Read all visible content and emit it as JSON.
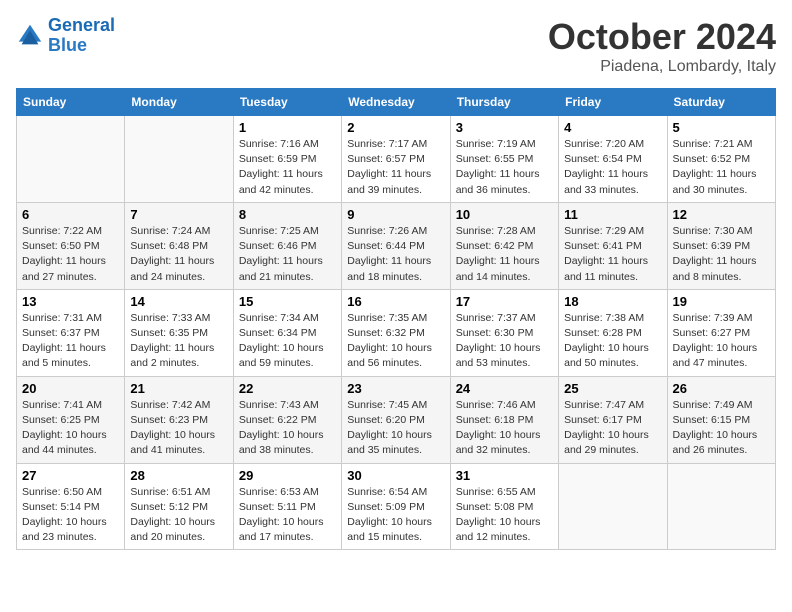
{
  "header": {
    "logo_line1": "General",
    "logo_line2": "Blue",
    "month": "October 2024",
    "location": "Piadena, Lombardy, Italy"
  },
  "weekdays": [
    "Sunday",
    "Monday",
    "Tuesday",
    "Wednesday",
    "Thursday",
    "Friday",
    "Saturday"
  ],
  "weeks": [
    [
      {
        "day": "",
        "sunrise": "",
        "sunset": "",
        "daylight": ""
      },
      {
        "day": "",
        "sunrise": "",
        "sunset": "",
        "daylight": ""
      },
      {
        "day": "1",
        "sunrise": "Sunrise: 7:16 AM",
        "sunset": "Sunset: 6:59 PM",
        "daylight": "Daylight: 11 hours and 42 minutes."
      },
      {
        "day": "2",
        "sunrise": "Sunrise: 7:17 AM",
        "sunset": "Sunset: 6:57 PM",
        "daylight": "Daylight: 11 hours and 39 minutes."
      },
      {
        "day": "3",
        "sunrise": "Sunrise: 7:19 AM",
        "sunset": "Sunset: 6:55 PM",
        "daylight": "Daylight: 11 hours and 36 minutes."
      },
      {
        "day": "4",
        "sunrise": "Sunrise: 7:20 AM",
        "sunset": "Sunset: 6:54 PM",
        "daylight": "Daylight: 11 hours and 33 minutes."
      },
      {
        "day": "5",
        "sunrise": "Sunrise: 7:21 AM",
        "sunset": "Sunset: 6:52 PM",
        "daylight": "Daylight: 11 hours and 30 minutes."
      }
    ],
    [
      {
        "day": "6",
        "sunrise": "Sunrise: 7:22 AM",
        "sunset": "Sunset: 6:50 PM",
        "daylight": "Daylight: 11 hours and 27 minutes."
      },
      {
        "day": "7",
        "sunrise": "Sunrise: 7:24 AM",
        "sunset": "Sunset: 6:48 PM",
        "daylight": "Daylight: 11 hours and 24 minutes."
      },
      {
        "day": "8",
        "sunrise": "Sunrise: 7:25 AM",
        "sunset": "Sunset: 6:46 PM",
        "daylight": "Daylight: 11 hours and 21 minutes."
      },
      {
        "day": "9",
        "sunrise": "Sunrise: 7:26 AM",
        "sunset": "Sunset: 6:44 PM",
        "daylight": "Daylight: 11 hours and 18 minutes."
      },
      {
        "day": "10",
        "sunrise": "Sunrise: 7:28 AM",
        "sunset": "Sunset: 6:42 PM",
        "daylight": "Daylight: 11 hours and 14 minutes."
      },
      {
        "day": "11",
        "sunrise": "Sunrise: 7:29 AM",
        "sunset": "Sunset: 6:41 PM",
        "daylight": "Daylight: 11 hours and 11 minutes."
      },
      {
        "day": "12",
        "sunrise": "Sunrise: 7:30 AM",
        "sunset": "Sunset: 6:39 PM",
        "daylight": "Daylight: 11 hours and 8 minutes."
      }
    ],
    [
      {
        "day": "13",
        "sunrise": "Sunrise: 7:31 AM",
        "sunset": "Sunset: 6:37 PM",
        "daylight": "Daylight: 11 hours and 5 minutes."
      },
      {
        "day": "14",
        "sunrise": "Sunrise: 7:33 AM",
        "sunset": "Sunset: 6:35 PM",
        "daylight": "Daylight: 11 hours and 2 minutes."
      },
      {
        "day": "15",
        "sunrise": "Sunrise: 7:34 AM",
        "sunset": "Sunset: 6:34 PM",
        "daylight": "Daylight: 10 hours and 59 minutes."
      },
      {
        "day": "16",
        "sunrise": "Sunrise: 7:35 AM",
        "sunset": "Sunset: 6:32 PM",
        "daylight": "Daylight: 10 hours and 56 minutes."
      },
      {
        "day": "17",
        "sunrise": "Sunrise: 7:37 AM",
        "sunset": "Sunset: 6:30 PM",
        "daylight": "Daylight: 10 hours and 53 minutes."
      },
      {
        "day": "18",
        "sunrise": "Sunrise: 7:38 AM",
        "sunset": "Sunset: 6:28 PM",
        "daylight": "Daylight: 10 hours and 50 minutes."
      },
      {
        "day": "19",
        "sunrise": "Sunrise: 7:39 AM",
        "sunset": "Sunset: 6:27 PM",
        "daylight": "Daylight: 10 hours and 47 minutes."
      }
    ],
    [
      {
        "day": "20",
        "sunrise": "Sunrise: 7:41 AM",
        "sunset": "Sunset: 6:25 PM",
        "daylight": "Daylight: 10 hours and 44 minutes."
      },
      {
        "day": "21",
        "sunrise": "Sunrise: 7:42 AM",
        "sunset": "Sunset: 6:23 PM",
        "daylight": "Daylight: 10 hours and 41 minutes."
      },
      {
        "day": "22",
        "sunrise": "Sunrise: 7:43 AM",
        "sunset": "Sunset: 6:22 PM",
        "daylight": "Daylight: 10 hours and 38 minutes."
      },
      {
        "day": "23",
        "sunrise": "Sunrise: 7:45 AM",
        "sunset": "Sunset: 6:20 PM",
        "daylight": "Daylight: 10 hours and 35 minutes."
      },
      {
        "day": "24",
        "sunrise": "Sunrise: 7:46 AM",
        "sunset": "Sunset: 6:18 PM",
        "daylight": "Daylight: 10 hours and 32 minutes."
      },
      {
        "day": "25",
        "sunrise": "Sunrise: 7:47 AM",
        "sunset": "Sunset: 6:17 PM",
        "daylight": "Daylight: 10 hours and 29 minutes."
      },
      {
        "day": "26",
        "sunrise": "Sunrise: 7:49 AM",
        "sunset": "Sunset: 6:15 PM",
        "daylight": "Daylight: 10 hours and 26 minutes."
      }
    ],
    [
      {
        "day": "27",
        "sunrise": "Sunrise: 6:50 AM",
        "sunset": "Sunset: 5:14 PM",
        "daylight": "Daylight: 10 hours and 23 minutes."
      },
      {
        "day": "28",
        "sunrise": "Sunrise: 6:51 AM",
        "sunset": "Sunset: 5:12 PM",
        "daylight": "Daylight: 10 hours and 20 minutes."
      },
      {
        "day": "29",
        "sunrise": "Sunrise: 6:53 AM",
        "sunset": "Sunset: 5:11 PM",
        "daylight": "Daylight: 10 hours and 17 minutes."
      },
      {
        "day": "30",
        "sunrise": "Sunrise: 6:54 AM",
        "sunset": "Sunset: 5:09 PM",
        "daylight": "Daylight: 10 hours and 15 minutes."
      },
      {
        "day": "31",
        "sunrise": "Sunrise: 6:55 AM",
        "sunset": "Sunset: 5:08 PM",
        "daylight": "Daylight: 10 hours and 12 minutes."
      },
      {
        "day": "",
        "sunrise": "",
        "sunset": "",
        "daylight": ""
      },
      {
        "day": "",
        "sunrise": "",
        "sunset": "",
        "daylight": ""
      }
    ]
  ]
}
